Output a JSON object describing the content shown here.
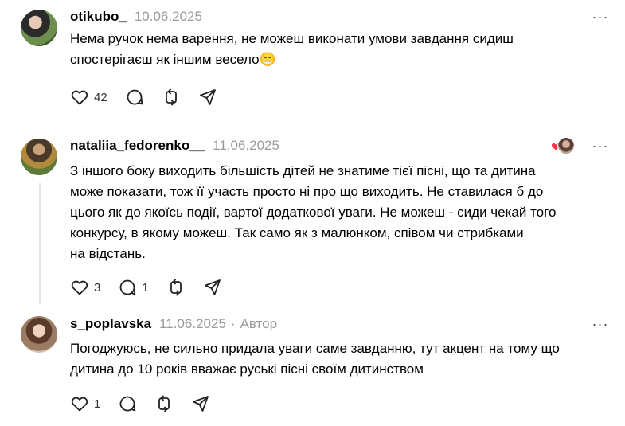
{
  "posts": [
    {
      "username": "otikubo_",
      "date": "10.06.2025",
      "text_line1": "Нема ручок нема варення, не можеш виконати умови завдання сидиш",
      "text_line2": "спостерігаєш як іншим весело😁",
      "likes": "42",
      "replies": "",
      "more": "···"
    },
    {
      "username": "nataliia_fedorenko__",
      "date": "11.06.2025",
      "text_lines": [
        "З іншого боку виходить більшість дітей не знатиме тієї пісні, що та дитина",
        "може показати, тож її участь просто ні про що виходить. Не ставилася б до",
        "цього як до якоїсь події, вартої додаткової уваги. Не можеш - сиди чекай того",
        "конкурсу, в якому можеш. Так само як з малюнком, співом чи стрибками",
        "на відстань."
      ],
      "likes": "3",
      "replies": "1",
      "more": "···"
    },
    {
      "username": "s_poplavska",
      "date": "11.06.2025",
      "separator": "·",
      "author_label": "Автор",
      "text_lines": [
        "Погоджуюсь, не сильно придала уваги саме завданню, тут акцент на тому що",
        "дитина до 10 років вважає руські пісні своїм дитинством"
      ],
      "likes": "1",
      "more": "···"
    }
  ],
  "icons": {
    "like": "heart-icon",
    "reply": "comment-icon",
    "repost": "repost-icon",
    "share": "share-icon",
    "more": "more-icon"
  },
  "colors": {
    "text": "#000000",
    "muted": "#9a9a9a",
    "divider": "#d9d9d9",
    "heart_badge": "#ff3040"
  }
}
